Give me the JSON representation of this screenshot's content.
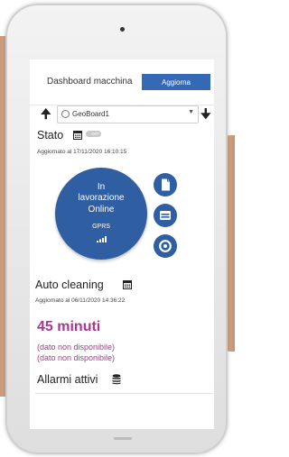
{
  "header": {
    "title": "Dashboard macchina",
    "update_button": "Aggiorna"
  },
  "device_select": {
    "selected": "GeoBoard1"
  },
  "stato": {
    "heading": "Stato",
    "toggle_label": "OFF",
    "updated": "Aggiornato al 17/11/2020 16:10:15"
  },
  "status_circle": {
    "line1": "In",
    "line2": "lavorazione",
    "line3": "Online",
    "line4": "GPRS"
  },
  "auto_cleaning": {
    "heading": "Auto cleaning",
    "updated": "Aggiornato al 06/11/2020 14:36:22",
    "duration": "45 minuti",
    "note1": "(dato non disponibile)",
    "note2": "(dato non disponibile)"
  },
  "alarms": {
    "heading": "Allarmi attivi"
  },
  "colors": {
    "primary": "#2f5ea3",
    "button": "#3569b6",
    "accent": "#a33a8e"
  }
}
